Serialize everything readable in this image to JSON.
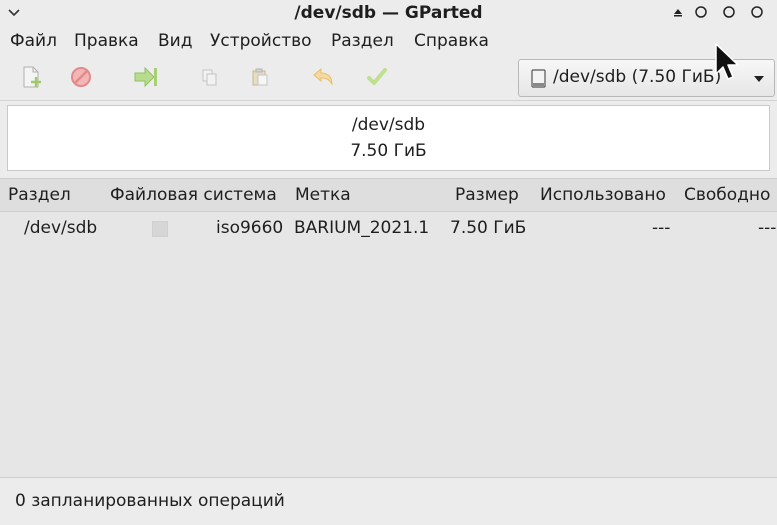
{
  "window": {
    "title": "/dev/sdb — GParted"
  },
  "menu": {
    "items": [
      "Файл",
      "Правка",
      "Вид",
      "Устройство",
      "Раздел",
      "Справка"
    ]
  },
  "toolbar": {
    "icons": [
      "new-partition-icon",
      "delete-icon",
      "resize-move-icon",
      "copy-icon",
      "paste-icon",
      "undo-icon",
      "apply-icon"
    ]
  },
  "device_selector": {
    "label": "/dev/sdb (7.50 ГиБ)"
  },
  "disk_map": {
    "line1": "/dev/sdb",
    "line2": "7.50 ГиБ"
  },
  "table": {
    "columns": [
      "Раздел",
      "Файловая система",
      "Метка",
      "Размер",
      "Использовано",
      "Свободно"
    ],
    "rows": [
      {
        "partition": "/dev/sdb",
        "filesystem": "iso9660",
        "label": "BARIUM_2021.1",
        "size": "7.50 ГиБ",
        "used": "---",
        "free": "---"
      }
    ]
  },
  "status": {
    "text": "0 запланированных операций"
  },
  "colors": {
    "delete_icon": "#e05050",
    "apply_icon": "#8ec63f",
    "resize_icon": "#7cc142",
    "undo_icon": "#f0b040",
    "fs_swatch": "#d6d6d6"
  }
}
